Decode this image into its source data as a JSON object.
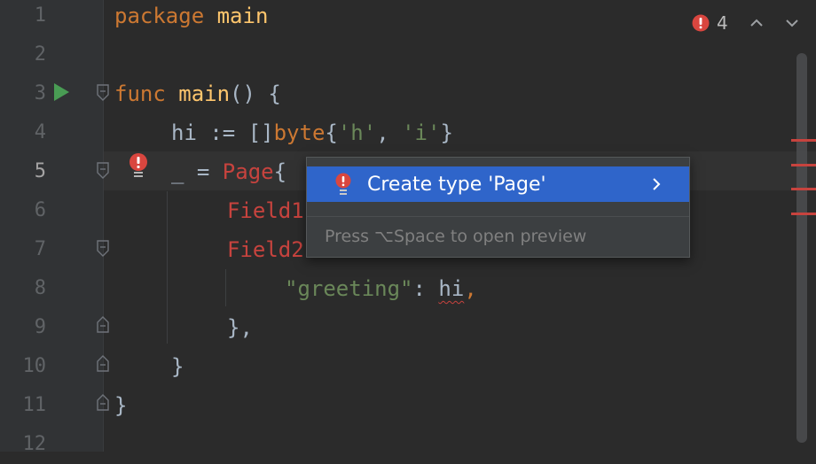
{
  "editor": {
    "lines": [
      {
        "number": "1"
      },
      {
        "number": "2"
      },
      {
        "number": "3"
      },
      {
        "number": "4"
      },
      {
        "number": "5"
      },
      {
        "number": "6"
      },
      {
        "number": "7"
      },
      {
        "number": "8"
      },
      {
        "number": "9"
      },
      {
        "number": "10"
      },
      {
        "number": "11"
      },
      {
        "number": "12"
      }
    ],
    "code": {
      "l1_kw": "package",
      "l1_name": " main",
      "l3_kw": "func",
      "l3_fn": " main",
      "l3_rest": "() {",
      "l4_pre": "hi := []",
      "l4_kw": "byte",
      "l4_brace": "{",
      "l4_s1": "'h'",
      "l4_comma": ", ",
      "l4_s2": "'i'",
      "l4_end": "}",
      "l5_pre": "_ = ",
      "l5_type": "Page",
      "l5_brace": "{",
      "l6_field": "Field1",
      "l7_field": "Field2",
      "l8_str": "\"greeting\"",
      "l8_colon": ": ",
      "l8_val": "hi",
      "l8_comma": ",",
      "l9": "},",
      "l10": "}",
      "l11": "}"
    }
  },
  "inspections": {
    "error_count": "4"
  },
  "popup": {
    "item_label": "Create type 'Page'",
    "hint": "Press ⌥Space to open preview"
  },
  "colors": {
    "background": "#2b2b2b",
    "keyword": "#cc7832",
    "function": "#ffc66d",
    "string": "#6a8759",
    "error": "#c7433e",
    "selection": "#2f65ca"
  }
}
